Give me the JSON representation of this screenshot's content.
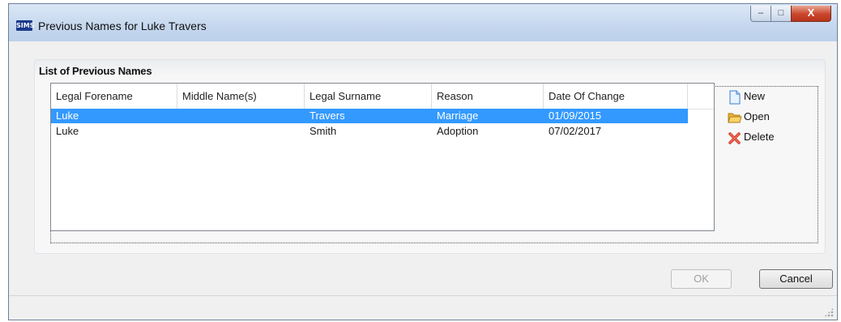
{
  "window": {
    "app_icon": "SIMS",
    "title": "Previous Names for Luke Travers",
    "minimize_label": "–",
    "maximize_label": "□",
    "close_label": "X"
  },
  "panel": {
    "title": "List of Previous Names"
  },
  "table": {
    "columns": [
      "Legal Forename",
      "Middle Name(s)",
      "Legal Surname",
      "Reason",
      "Date Of Change"
    ],
    "rows": [
      {
        "forename": "Luke",
        "middle": "",
        "surname": "Travers",
        "reason": "Marriage",
        "date": "01/09/2015",
        "selected": true
      },
      {
        "forename": "Luke",
        "middle": "",
        "surname": "Smith",
        "reason": "Adoption",
        "date": "07/02/2017",
        "selected": false
      }
    ]
  },
  "actions": {
    "new_label": "New",
    "open_label": "Open",
    "delete_label": "Delete"
  },
  "buttons": {
    "ok_label": "OK",
    "cancel_label": "Cancel"
  },
  "colors": {
    "selection": "#3399ff",
    "close_button": "#c9452b"
  }
}
